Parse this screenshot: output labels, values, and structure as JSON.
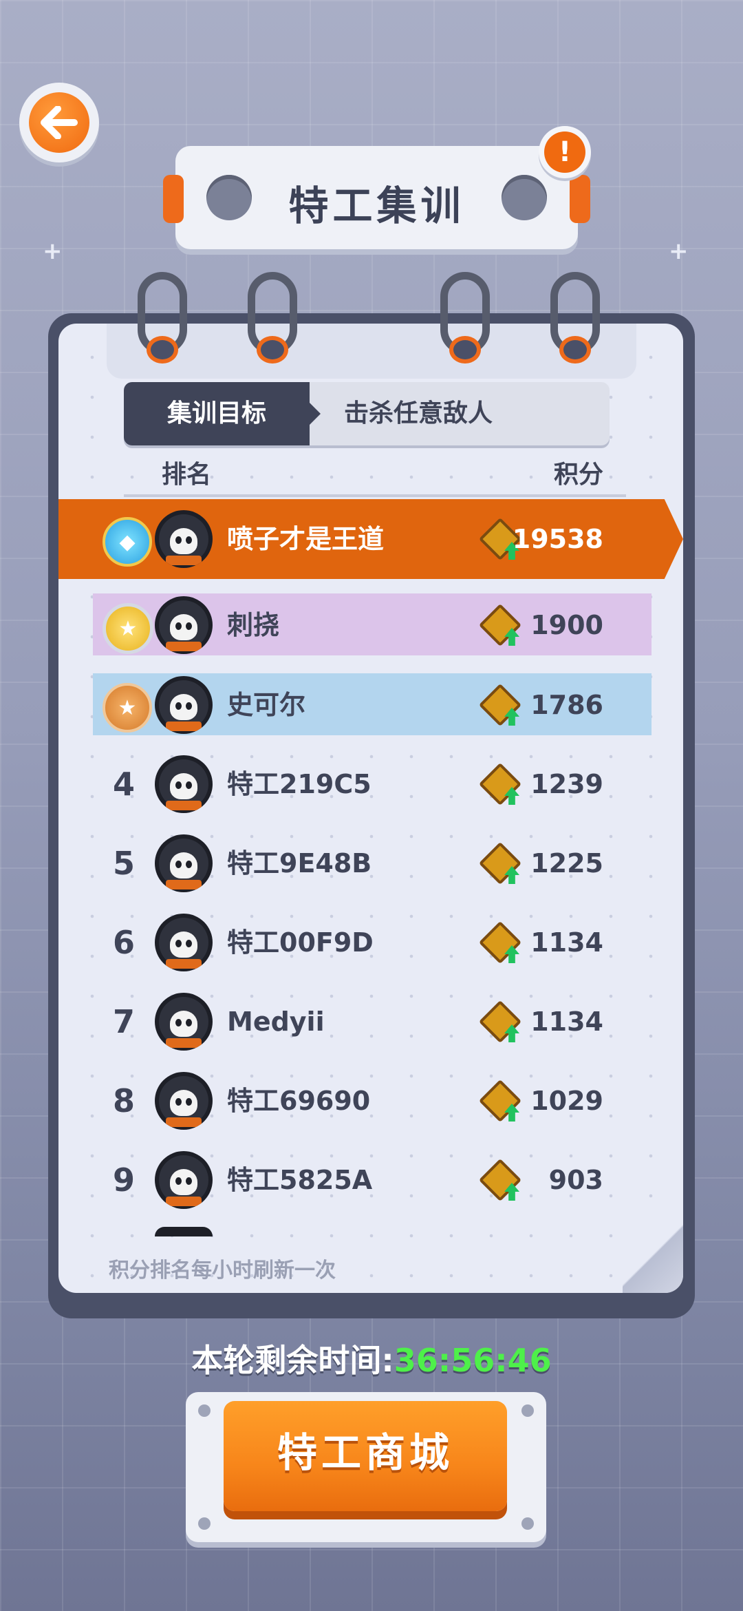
{
  "header": {
    "title": "特工集训",
    "back_icon": "arrow-left-icon",
    "alert_icon": "exclamation-icon",
    "alert_symbol": "!"
  },
  "tabs": {
    "active_label": "集训目标",
    "objective_label": "击杀任意敌人"
  },
  "columns": {
    "rank": "排名",
    "score": "积分"
  },
  "leaderboard": [
    {
      "rank": "",
      "name": "喷子才是王道",
      "score": "19538",
      "medal": "diamond"
    },
    {
      "rank": "",
      "name": "刺挠",
      "score": "1900",
      "medal": "silver"
    },
    {
      "rank": "",
      "name": "史可尔",
      "score": "1786",
      "medal": "bronze"
    },
    {
      "rank": "4",
      "name": "特工219C5",
      "score": "1239"
    },
    {
      "rank": "5",
      "name": "特工9E48B",
      "score": "1225"
    },
    {
      "rank": "6",
      "name": "特工00F9D",
      "score": "1134"
    },
    {
      "rank": "7",
      "name": "Medyii",
      "score": "1134"
    },
    {
      "rank": "8",
      "name": "特工69690",
      "score": "1029"
    },
    {
      "rank": "9",
      "name": "特工5825A",
      "score": "903"
    }
  ],
  "footer": {
    "refresh_note": "积分排名每小时刷新一次",
    "timer_label": "本轮剩余时间:",
    "timer_value": "36:56:46",
    "shop_button": "特工商城"
  },
  "colors": {
    "accent_orange": "#e0650e",
    "silver_band": "#dcc4ea",
    "bronze_band": "#b3d5ee",
    "timer_green": "#4ef04a"
  }
}
